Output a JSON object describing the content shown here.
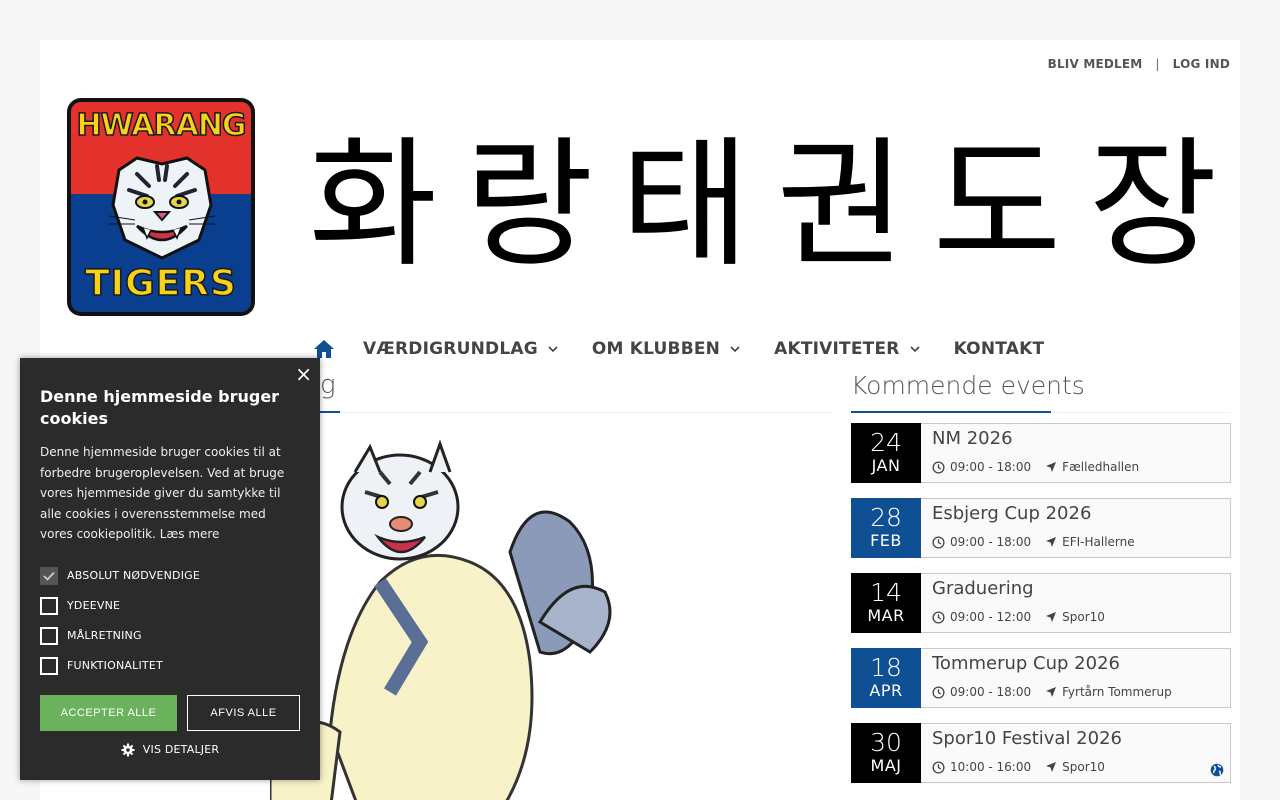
{
  "header": {
    "links": {
      "join": "BLIV MEDLEM",
      "separator": "|",
      "login": "LOG IND"
    },
    "logo": {
      "top_text": "HWARANG",
      "bottom_text": "TIGERS"
    },
    "hangul": [
      "화",
      "랑",
      "태",
      "권",
      "도",
      "장"
    ]
  },
  "nav": {
    "home_icon": "home-icon",
    "items": [
      {
        "label": "VÆRDIGRUNDLAG",
        "has_dropdown": true
      },
      {
        "label": "OM KLUBBEN",
        "has_dropdown": true
      },
      {
        "label": "AKTIVITETER",
        "has_dropdown": true
      },
      {
        "label": "KONTAKT",
        "has_dropdown": false
      }
    ]
  },
  "main": {
    "heading_partial": "g"
  },
  "events": {
    "title": "Kommende events",
    "items": [
      {
        "day": "24",
        "month": "JAN",
        "name": "NM 2026",
        "time": "09:00 - 18:00",
        "location": "Fælledhallen",
        "date_style": "dark"
      },
      {
        "day": "28",
        "month": "FEB",
        "name": "Esbjerg Cup 2026",
        "time": "09:00 - 18:00",
        "location": "EFI-Hallerne",
        "date_style": "blue"
      },
      {
        "day": "14",
        "month": "MAR",
        "name": "Graduering",
        "time": "09:00 - 12:00",
        "location": "Spor10",
        "date_style": "dark"
      },
      {
        "day": "18",
        "month": "APR",
        "name": "Tommerup Cup 2026",
        "time": "09:00 - 18:00",
        "location": "Fyrtårn Tommerup",
        "date_style": "blue"
      },
      {
        "day": "30",
        "month": "MAJ",
        "name": "Spor10 Festival 2026",
        "time": "10:00 - 16:00",
        "location": "Spor10",
        "date_style": "dark"
      }
    ]
  },
  "cookie": {
    "close": "×",
    "title": "Denne hjemmeside bruger cookies",
    "text": "Denne hjemmeside bruger cookies til at forbedre brugeroplevelsen. Ved at bruge vores hjemmeside giver du samtykke til alle cookies i overensstemmelse med vores cookiepolitik.",
    "read_more": "Læs mere",
    "options": [
      {
        "label": "ABSOLUT NØDVENDIGE",
        "checked": true
      },
      {
        "label": "YDEEVNE",
        "checked": false
      },
      {
        "label": "MÅLRETNING",
        "checked": false
      },
      {
        "label": "FUNKTIONALITET",
        "checked": false
      }
    ],
    "accept": "ACCEPTER ALLE",
    "reject": "AFVIS ALLE",
    "details": "VIS DETALJER"
  },
  "colors": {
    "accent_blue": "#0f4f94",
    "accept_green": "#6ab25b",
    "cookie_bg": "#2b2b2b"
  }
}
